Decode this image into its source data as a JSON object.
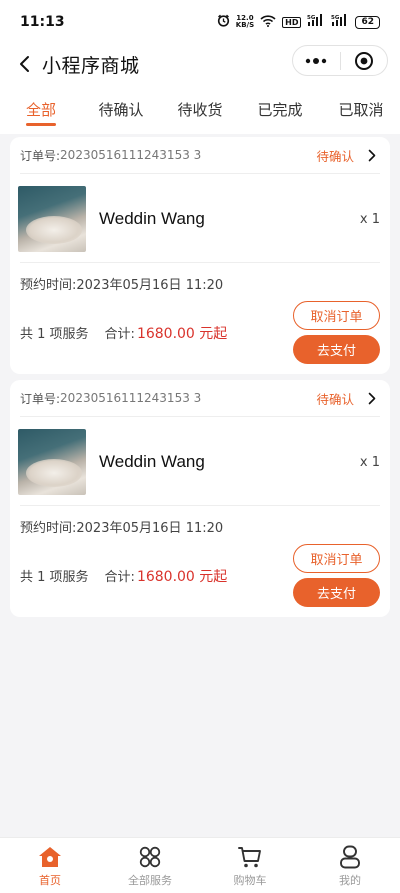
{
  "status_bar": {
    "time": "11:13",
    "speed_value": "12.0",
    "speed_unit": "KB/S",
    "hd_badge": "HD",
    "signal1_label": "5G",
    "signal2_label": "5G",
    "battery": "62"
  },
  "nav": {
    "title": "小程序商城"
  },
  "tabs": [
    {
      "label": "全部",
      "active": true
    },
    {
      "label": "待确认",
      "active": false
    },
    {
      "label": "待收货",
      "active": false
    },
    {
      "label": "已完成",
      "active": false
    },
    {
      "label": "已取消",
      "active": false
    }
  ],
  "orders": [
    {
      "order_no_label": "订单号:",
      "order_no": "20230516111243153 3",
      "status": "待确认",
      "product_name": "Weddin Wang",
      "qty": "x 1",
      "appt_label": "预约时间:",
      "appt_time": "2023年05月16日 11:20",
      "service_count": "共 1 项服务",
      "total_label": "合计:",
      "total_amount": "1680.00 元起",
      "cancel_label": "取消订单",
      "pay_label": "去支付"
    },
    {
      "order_no_label": "订单号:",
      "order_no": "20230516111243153 3",
      "status": "待确认",
      "product_name": "Weddin Wang",
      "qty": "x 1",
      "appt_label": "预约时间:",
      "appt_time": "2023年05月16日 11:20",
      "service_count": "共 1 项服务",
      "total_label": "合计:",
      "total_amount": "1680.00 元起",
      "cancel_label": "取消订单",
      "pay_label": "去支付"
    }
  ],
  "bottom_nav": [
    {
      "label": "首页",
      "icon": "home-icon",
      "active": true
    },
    {
      "label": "全部服务",
      "icon": "grid-icon",
      "active": false
    },
    {
      "label": "购物车",
      "icon": "cart-icon",
      "active": false
    },
    {
      "label": "我的",
      "icon": "user-icon",
      "active": false
    }
  ],
  "colors": {
    "accent": "#e8622c",
    "price": "#d9332c",
    "background": "#f4f4f6"
  }
}
